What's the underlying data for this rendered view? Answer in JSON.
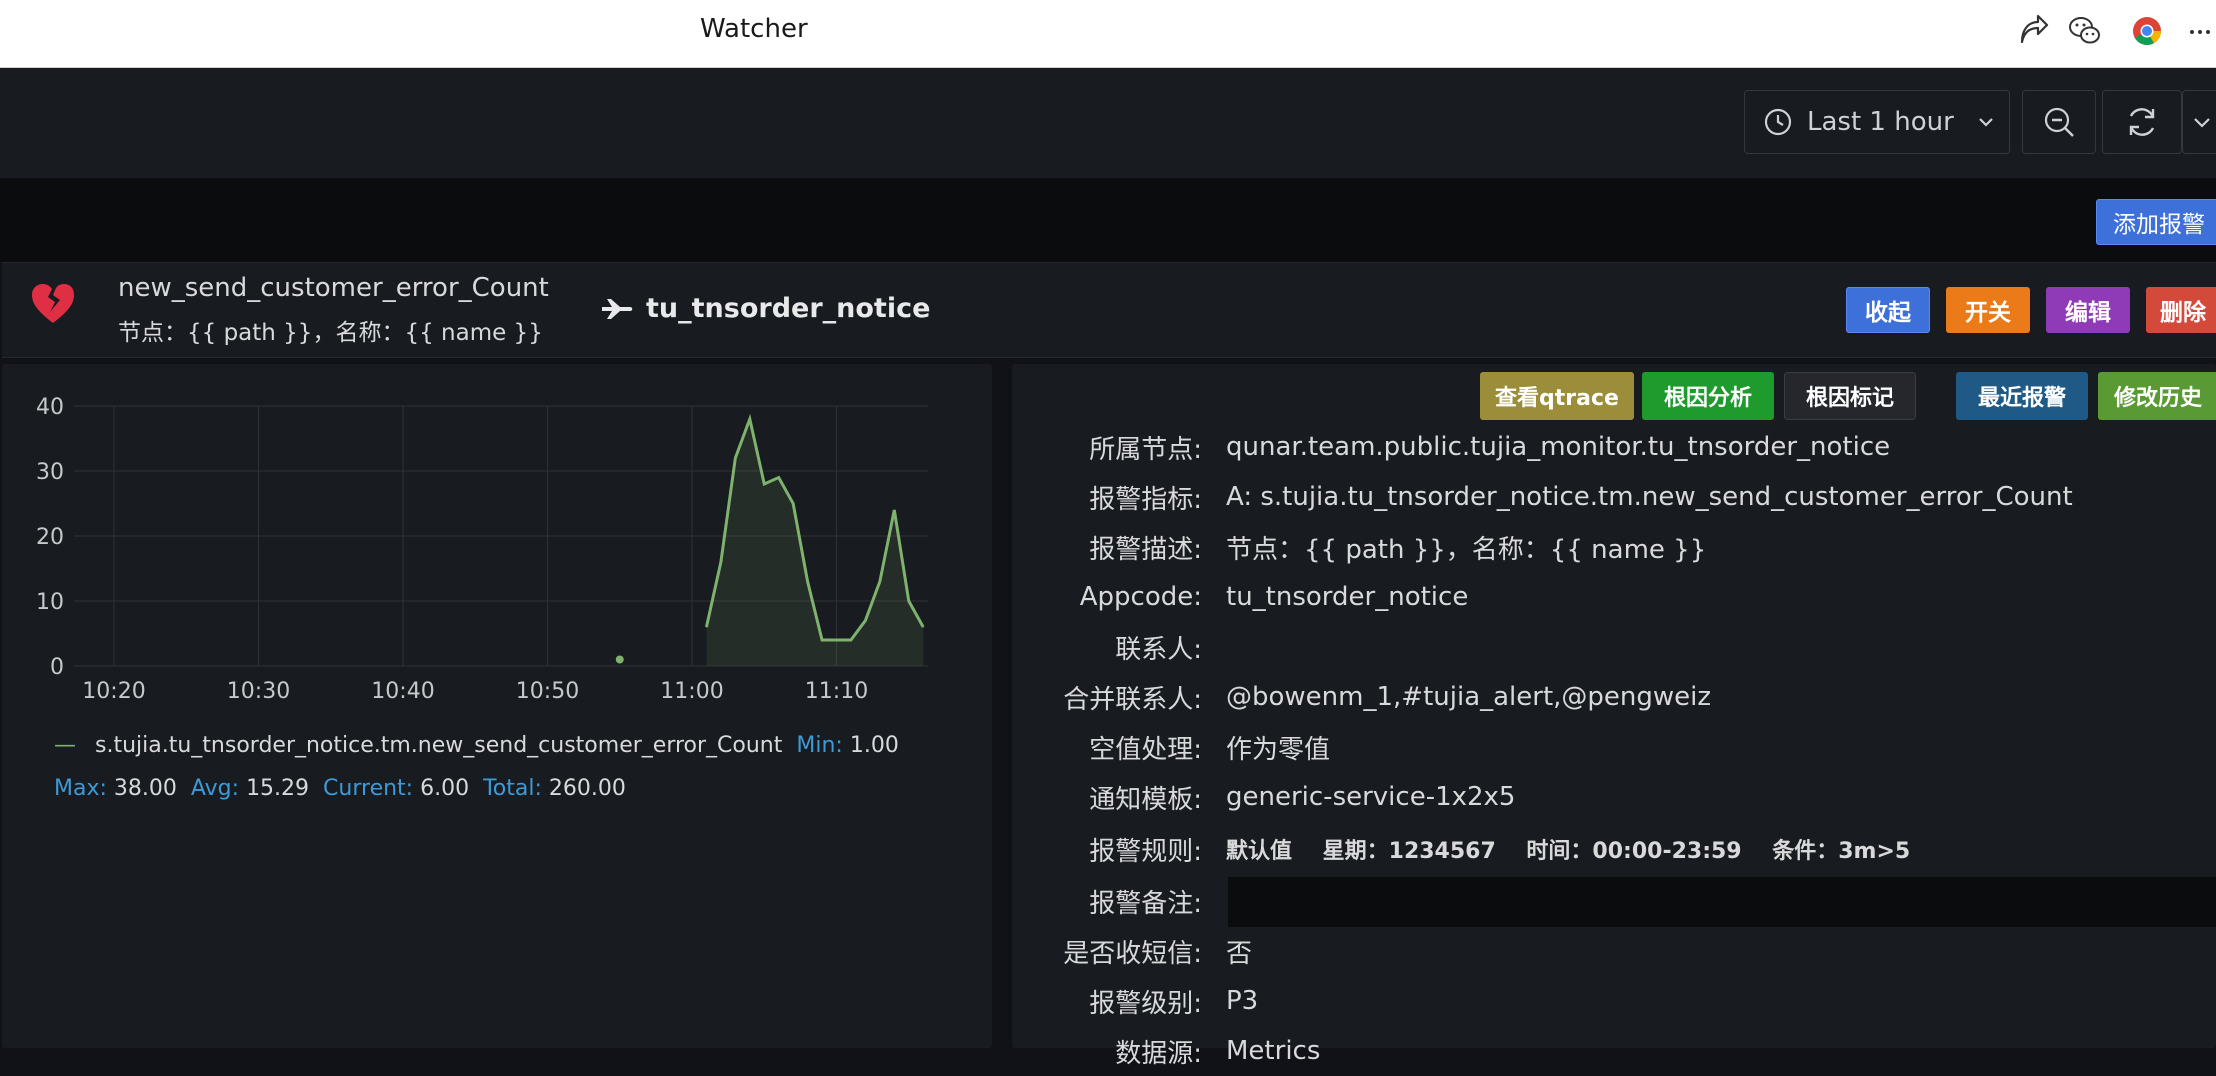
{
  "window": {
    "title": "Watcher"
  },
  "toolbar": {
    "time_range": "Last 1 hour"
  },
  "header_actions": {
    "add_alert": "添加报警"
  },
  "panel": {
    "metric_name": "new_send_customer_error_Count",
    "metric_subtitle": "节点：{{ path }}，名称：{{ name }}",
    "app_name": "tu_tnsorder_notice",
    "buttons": {
      "collapse": "收起",
      "switch": "开关",
      "edit": "编辑",
      "delete": "删除"
    }
  },
  "actions": {
    "qtrace": "查看qtrace",
    "root_cause_analysis": "根因分析",
    "root_cause_mark": "根因标记",
    "recent_alerts": "最近报警",
    "edit_history": "修改历史"
  },
  "details": [
    {
      "label": "所属节点:",
      "value": "qunar.team.public.tujia_monitor.tu_tnsorder_notice"
    },
    {
      "label": "报警指标:",
      "value": "A: s.tujia.tu_tnsorder_notice.tm.new_send_customer_error_Count"
    },
    {
      "label": "报警描述:",
      "value": "节点：{{ path }}，名称：{{ name }}"
    },
    {
      "label": "Appcode:",
      "value": "tu_tnsorder_notice"
    },
    {
      "label": "联系人:",
      "value": ""
    },
    {
      "label": "合并联系人:",
      "value": "@bowenm_1,#tujia_alert,@pengweiz"
    },
    {
      "label": "空值处理:",
      "value": "作为零值"
    },
    {
      "label": "通知模板:",
      "value": "generic-service-1x2x5"
    },
    {
      "label": "报警规则:",
      "value": "默认值    星期：1234567    时间：00:00-23:59    条件：3m>5"
    },
    {
      "label": "报警备注:",
      "value": ""
    },
    {
      "label": "是否收短信:",
      "value": "否"
    },
    {
      "label": "报警级别:",
      "value": "P3"
    },
    {
      "label": "数据源:",
      "value": "Metrics"
    }
  ],
  "legend": {
    "series": "s.tujia.tu_tnsorder_notice.tm.new_send_customer_error_Count",
    "min_label": "Min:",
    "min": "1.00",
    "max_label": "Max:",
    "max": "38.00",
    "avg_label": "Avg:",
    "avg": "15.29",
    "current_label": "Current:",
    "current": "6.00",
    "total_label": "Total:",
    "total": "260.00"
  },
  "chart_data": {
    "type": "area",
    "title": "",
    "xlabel": "",
    "ylabel": "",
    "x_ticks": [
      "10:20",
      "10:30",
      "10:40",
      "10:50",
      "11:00",
      "11:10"
    ],
    "y_ticks": [
      0,
      10,
      20,
      30,
      40
    ],
    "ylim": [
      0,
      40
    ],
    "grid": true,
    "series": [
      {
        "name": "s.tujia.tu_tnsorder_notice.tm.new_send_customer_error_Count",
        "color": "#7eb26d",
        "isolated_points": [
          {
            "x": "10:55",
            "y": 1
          }
        ],
        "points": [
          {
            "x": "11:01",
            "y": 6
          },
          {
            "x": "11:02",
            "y": 16
          },
          {
            "x": "11:03",
            "y": 32
          },
          {
            "x": "11:04",
            "y": 38
          },
          {
            "x": "11:05",
            "y": 28
          },
          {
            "x": "11:06",
            "y": 29
          },
          {
            "x": "11:07",
            "y": 25
          },
          {
            "x": "11:08",
            "y": 13
          },
          {
            "x": "11:09",
            "y": 4
          },
          {
            "x": "11:10",
            "y": 4
          },
          {
            "x": "11:11",
            "y": 4
          },
          {
            "x": "11:12",
            "y": 7
          },
          {
            "x": "11:13",
            "y": 13
          },
          {
            "x": "11:14",
            "y": 24
          },
          {
            "x": "11:15",
            "y": 10
          },
          {
            "x": "11:16",
            "y": 6
          }
        ]
      }
    ]
  }
}
